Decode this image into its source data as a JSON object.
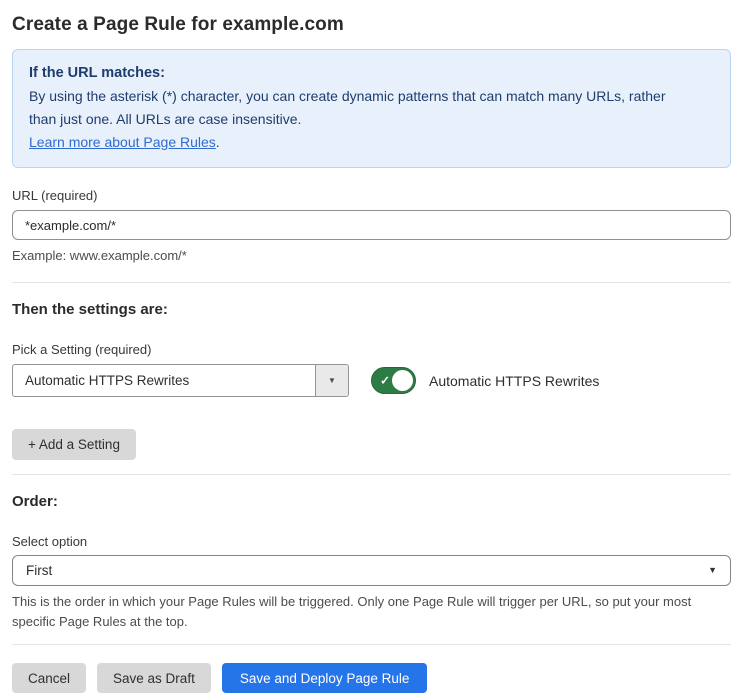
{
  "page": {
    "title": "Create a Page Rule for example.com"
  },
  "info_box": {
    "heading": "If the URL matches:",
    "body": "By using the asterisk (*) character, you can create dynamic patterns that can match many URLs, rather than just one. All URLs are case insensitive.",
    "link_text": "Learn more about Page Rules",
    "link_suffix": "."
  },
  "url_field": {
    "label": "URL (required)",
    "value": "*example.com/*",
    "helper": "Example: www.example.com/*"
  },
  "settings_section": {
    "heading": "Then the settings are:",
    "picker_label": "Pick a Setting (required)",
    "picker_value": "Automatic HTTPS Rewrites",
    "toggle_state": "on",
    "toggle_label": "Automatic HTTPS Rewrites",
    "add_setting_button": "+ Add a Setting"
  },
  "order_section": {
    "heading": "Order:",
    "select_label": "Select option",
    "select_value": "First",
    "helper": "This is the order in which your Page Rules will be triggered. Only one Page Rule will trigger per URL, so put your most specific Page Rules at the top."
  },
  "footer": {
    "cancel_label": "Cancel",
    "save_draft_label": "Save as Draft",
    "deploy_label": "Save and Deploy Page Rule"
  },
  "icons": {
    "setting_select_caret": "chevron-down-icon",
    "order_select_caret": "chevron-down-icon",
    "toggle_check": "check-icon"
  },
  "colors": {
    "accent_blue": "#2575e8",
    "toggle_green": "#2d7b45",
    "info_bg": "#e8f1fb",
    "info_border": "#b9d4f1",
    "info_text": "#1e3c6e",
    "link_blue": "#2f6bcf"
  }
}
